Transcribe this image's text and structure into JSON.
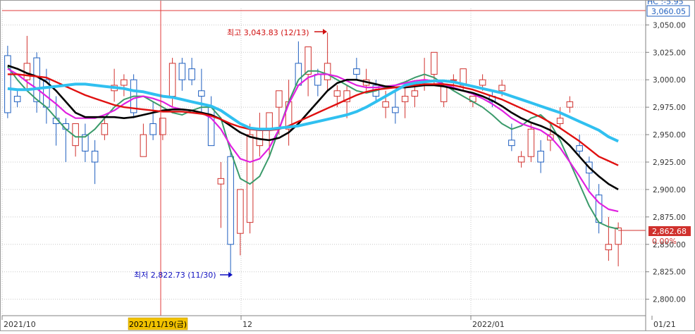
{
  "top_label": "HC :-5.95",
  "current_price_top": "3,060.05",
  "last_price": "2,862.68",
  "last_change": "0.00%",
  "annotations": {
    "high_text": "최고 3,043.83 (12/13)",
    "low_text": "최저 2,822.73 (11/30)"
  },
  "crosshair": {
    "x_label": "2021/11/19(금)",
    "y_value": 3060.05
  },
  "colors": {
    "bg": "#ffffff",
    "grid": "#c8c8c8",
    "up": "#d0312d",
    "down": "#1f5fbf",
    "ma_green": "#3a9a6a",
    "ma_magenta": "#e020e0",
    "ma_black": "#000000",
    "ma_red": "#e01010",
    "ma_cyan": "#30c0f0",
    "crosshair": "#e23b3b",
    "high_annot": "#d01010",
    "low_annot": "#1010c0"
  },
  "chart_data": {
    "type": "candlestick",
    "ylim": [
      2785,
      3065
    ],
    "y_ticks": [
      "3,050.00",
      "3,025.00",
      "3,000.00",
      "2,975.00",
      "2,950.00",
      "2,925.00",
      "2,900.00",
      "2,875.00",
      "2,850.00",
      "2,825.00",
      "2,800.00"
    ],
    "x_labels": [
      "2021/10",
      "12",
      "2022/01",
      "01/21"
    ],
    "candles": [
      [
        3022,
        3031,
        2965,
        2970
      ],
      [
        2985,
        2990,
        2975,
        2980
      ],
      [
        3000,
        3040,
        2990,
        3015
      ],
      [
        3020,
        3025,
        2970,
        2980
      ],
      [
        3000,
        3010,
        2960,
        2975
      ],
      [
        2965,
        2985,
        2940,
        2960
      ],
      [
        2960,
        2965,
        2925,
        2955
      ],
      [
        2940,
        2955,
        2930,
        2960
      ],
      [
        2950,
        2960,
        2925,
        2935
      ],
      [
        2935,
        2945,
        2905,
        2925
      ],
      [
        2950,
        2965,
        2945,
        2960
      ],
      [
        2990,
        3010,
        2980,
        2995
      ],
      [
        2995,
        3005,
        2985,
        3000
      ],
      [
        3000,
        3005,
        2965,
        2970
      ],
      [
        2930,
        2960,
        2935,
        2950
      ],
      [
        2960,
        2980,
        2945,
        2950
      ],
      [
        2950,
        2960,
        2945,
        2965
      ],
      [
        2985,
        3020,
        2975,
        3015
      ],
      [
        3015,
        3020,
        2990,
        3000
      ],
      [
        3010,
        3020,
        2995,
        3000
      ],
      [
        2990,
        3010,
        2970,
        2985
      ],
      [
        2975,
        2985,
        2940,
        2940
      ],
      [
        2905,
        2925,
        2865,
        2910
      ],
      [
        2930,
        2935,
        2822,
        2850
      ],
      [
        2860,
        2890,
        2840,
        2900
      ],
      [
        2870,
        2960,
        2860,
        2950
      ],
      [
        2940,
        2970,
        2930,
        2955
      ],
      [
        2955,
        2970,
        2930,
        2970
      ],
      [
        2975,
        2980,
        2950,
        2990
      ],
      [
        2955,
        3000,
        2940,
        2980
      ],
      [
        3015,
        3035,
        2995,
        2995
      ],
      [
        3005,
        3020,
        2985,
        3030
      ],
      [
        3005,
        3010,
        2985,
        2995
      ],
      [
        3000,
        3043,
        2990,
        3015
      ],
      [
        2985,
        2995,
        2975,
        2990
      ],
      [
        2980,
        2995,
        2965,
        2990
      ],
      [
        3010,
        3020,
        3000,
        3005
      ],
      [
        2995,
        3010,
        2990,
        3000
      ],
      [
        2995,
        3000,
        2980,
        2985
      ],
      [
        2975,
        2990,
        2965,
        2980
      ],
      [
        2975,
        2990,
        2960,
        2970
      ],
      [
        2980,
        2995,
        2965,
        2985
      ],
      [
        2985,
        2995,
        2975,
        2990
      ],
      [
        3000,
        3020,
        2990,
        3000
      ],
      [
        3005,
        3015,
        2995,
        3025
      ],
      [
        2980,
        2990,
        2975,
        2995
      ],
      [
        3000,
        3005,
        2990,
        3000
      ],
      [
        2995,
        3005,
        2990,
        3010
      ],
      [
        2980,
        2985,
        2975,
        2985
      ],
      [
        2995,
        3005,
        2990,
        3000
      ],
      [
        2985,
        2990,
        2975,
        2980
      ],
      [
        2990,
        3000,
        2985,
        2995
      ],
      [
        2945,
        2960,
        2935,
        2940
      ],
      [
        2925,
        2935,
        2920,
        2930
      ],
      [
        2930,
        2960,
        2925,
        2955
      ],
      [
        2935,
        2945,
        2915,
        2925
      ],
      [
        2945,
        2960,
        2935,
        2950
      ],
      [
        2960,
        2975,
        2955,
        2965
      ],
      [
        2975,
        2985,
        2970,
        2980
      ],
      [
        2940,
        2950,
        2930,
        2935
      ],
      [
        2925,
        2930,
        2900,
        2915
      ],
      [
        2895,
        2905,
        2860,
        2870
      ],
      [
        2845,
        2875,
        2835,
        2850
      ],
      [
        2850,
        2870,
        2830,
        2865
      ]
    ],
    "ma": [
      {
        "values": [
          3012,
          3000,
          2990,
          2982,
          2975,
          2965,
          2955,
          2948,
          2948,
          2955,
          2965,
          2975,
          2982,
          2985,
          2985,
          2980,
          2975,
          2970,
          2968,
          2972,
          2975,
          2975,
          2965,
          2935,
          2910,
          2905,
          2912,
          2930,
          2955,
          2980,
          3000,
          3008,
          3008,
          3005,
          3000,
          2995,
          2990,
          2988,
          2990,
          2993,
          2995,
          2998,
          3002,
          3005,
          3002,
          2996,
          2990,
          2985,
          2980,
          2975,
          2968,
          2960,
          2955,
          2958,
          2965,
          2968,
          2960,
          2945,
          2925,
          2905,
          2885,
          2870,
          2866,
          2864
        ]
      },
      {
        "values": [
          3010,
          3005,
          2998,
          2992,
          2985,
          2978,
          2970,
          2965,
          2965,
          2965,
          2968,
          2972,
          2978,
          2983,
          2985,
          2983,
          2980,
          2975,
          2973,
          2972,
          2970,
          2965,
          2955,
          2940,
          2928,
          2925,
          2928,
          2938,
          2955,
          2978,
          2995,
          3002,
          3005,
          3005,
          3003,
          2999,
          2995,
          2993,
          2993,
          2994,
          2995,
          2997,
          2999,
          3000,
          2999,
          2996,
          2993,
          2990,
          2987,
          2983,
          2978,
          2972,
          2965,
          2960,
          2957,
          2954,
          2948,
          2938,
          2925,
          2912,
          2898,
          2888,
          2882,
          2880
        ]
      },
      {
        "values": [
          3013,
          3010,
          3006,
          3003,
          2998,
          2990,
          2980,
          2970,
          2966,
          2966,
          2966,
          2966,
          2965,
          2966,
          2968,
          2970,
          2972,
          2973,
          2973,
          2972,
          2970,
          2968,
          2964,
          2958,
          2952,
          2948,
          2946,
          2945,
          2947,
          2952,
          2960,
          2970,
          2980,
          2990,
          2997,
          3000,
          3000,
          2998,
          2996,
          2994,
          2993,
          2993,
          2994,
          2995,
          2995,
          2994,
          2992,
          2990,
          2988,
          2985,
          2981,
          2976,
          2970,
          2965,
          2961,
          2958,
          2954,
          2948,
          2940,
          2930,
          2920,
          2912,
          2905,
          2900
        ]
      },
      {
        "values": [
          3005,
          3005,
          3004,
          3003,
          3002,
          2998,
          2994,
          2990,
          2986,
          2983,
          2980,
          2977,
          2975,
          2974,
          2973,
          2972,
          2971,
          2971,
          2971,
          2970,
          2969,
          2967,
          2964,
          2960,
          2957,
          2955,
          2954,
          2954,
          2955,
          2958,
          2962,
          2966,
          2970,
          2974,
          2978,
          2982,
          2986,
          2989,
          2991,
          2992,
          2993,
          2994,
          2995,
          2996,
          2996,
          2996,
          2995,
          2993,
          2991,
          2988,
          2985,
          2982,
          2978,
          2974,
          2970,
          2966,
          2961,
          2956,
          2950,
          2944,
          2937,
          2930,
          2926,
          2922
        ]
      },
      {
        "values": [
          2992,
          2991,
          2991,
          2992,
          2993,
          2994,
          2995,
          2996,
          2996,
          2995,
          2994,
          2993,
          2992,
          2990,
          2989,
          2987,
          2985,
          2984,
          2982,
          2980,
          2978,
          2976,
          2972,
          2966,
          2960,
          2956,
          2955,
          2955,
          2956,
          2957,
          2958,
          2960,
          2962,
          2964,
          2966,
          2968,
          2971,
          2975,
          2980,
          2985,
          2990,
          2995,
          2997,
          2998,
          2999,
          2999,
          2998,
          2996,
          2994,
          2992,
          2990,
          2988,
          2985,
          2982,
          2979,
          2976,
          2973,
          2970,
          2966,
          2962,
          2958,
          2954,
          2948,
          2944
        ]
      }
    ]
  }
}
